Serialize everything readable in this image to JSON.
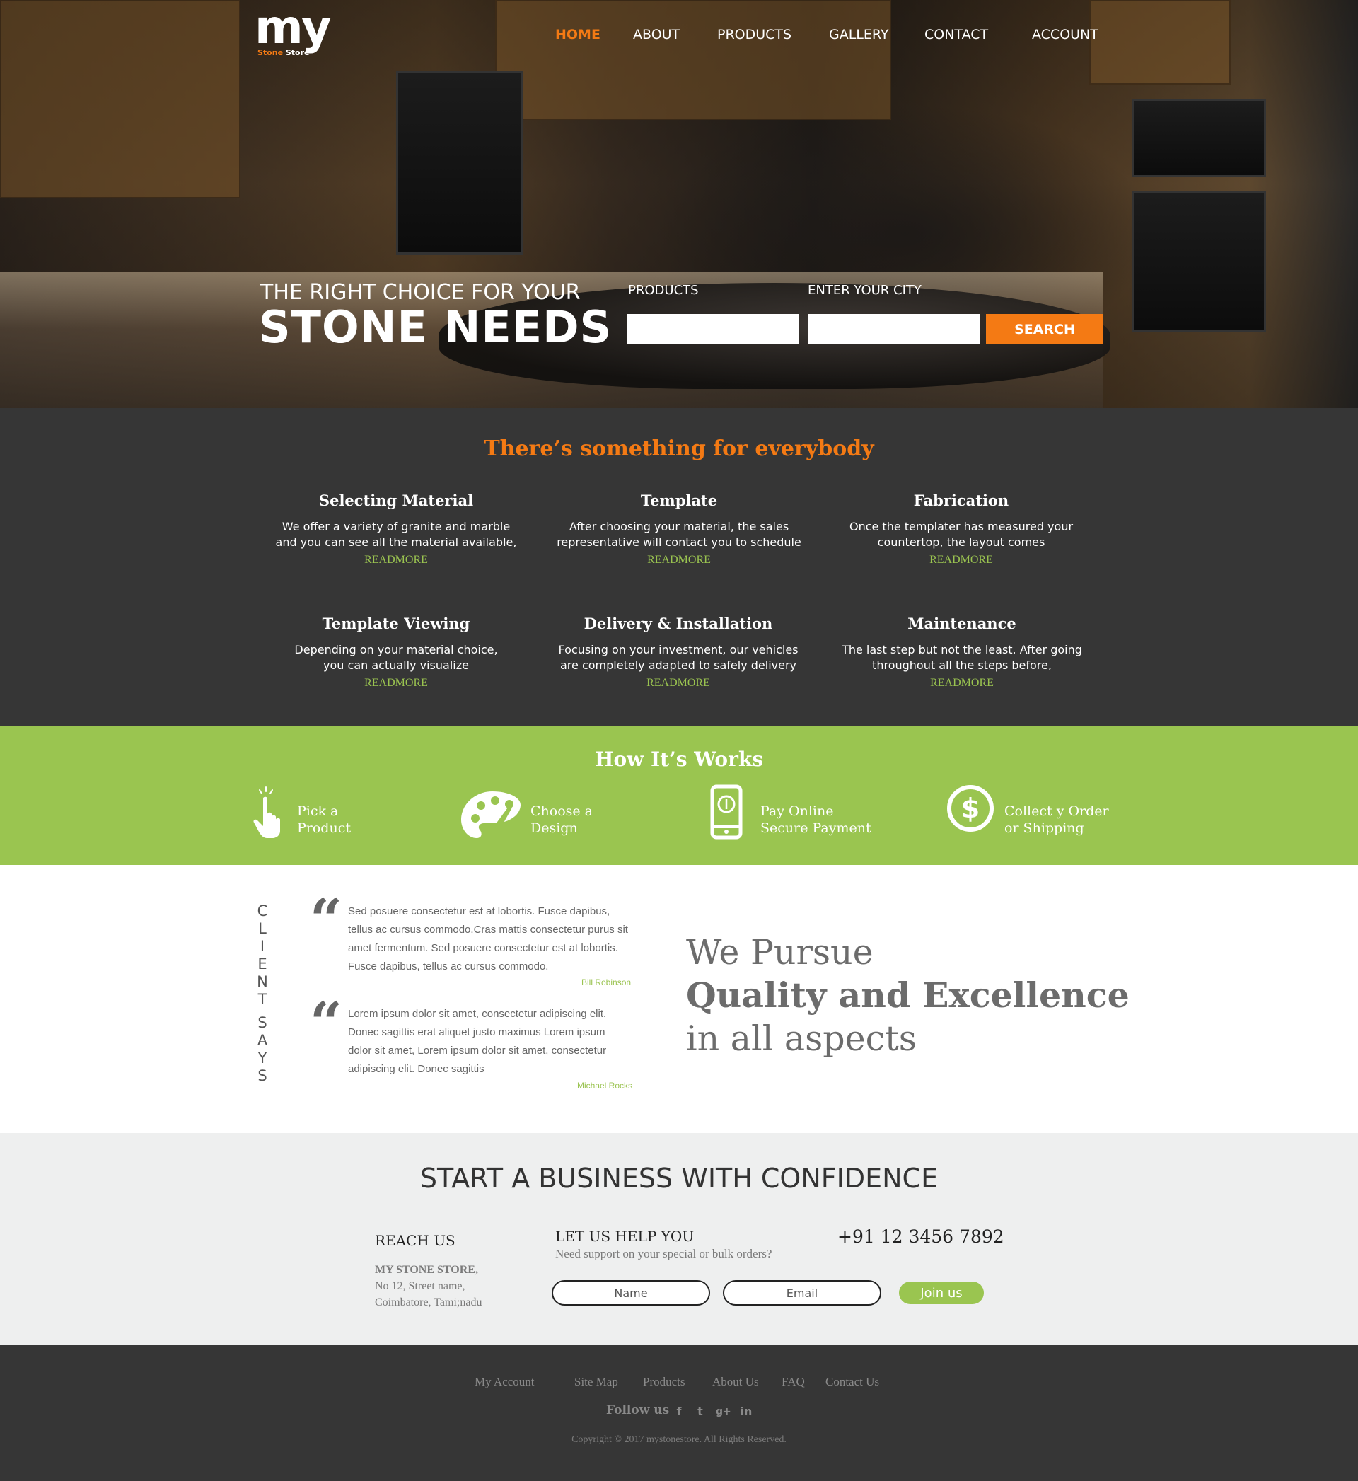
{
  "brand": {
    "logo_main": "my",
    "logo_sub_accent": "Stone",
    "logo_sub_rest": "Store"
  },
  "nav": {
    "items": [
      "HOME",
      "ABOUT",
      "PRODUCTS",
      "GALLERY",
      "CONTACT",
      "ACCOUNT"
    ],
    "active": "HOME"
  },
  "hero": {
    "subtitle": "THE RIGHT CHOICE  FOR YOUR",
    "title": "STONE NEEDS",
    "products_label": "PRODUCTS",
    "city_label": "ENTER YOUR CITY",
    "products_value": "",
    "city_value": "",
    "search_label": "SEARCH"
  },
  "services": {
    "title": "There’s something for everybody",
    "readmore": "READMORE",
    "items": [
      {
        "title": "Selecting Material",
        "line1": "We offer a variety of granite and marble",
        "line2": "and you can see all the material available,"
      },
      {
        "title": "Template",
        "line1": "After choosing your material, the sales",
        "line2": "representative will contact you to schedule"
      },
      {
        "title": "Fabrication",
        "line1": "Once the templater has measured your",
        "line2": "countertop, the layout comes"
      },
      {
        "title": "Template Viewing",
        "line1": "Depending on your material choice,",
        "line2": "you can actually visualize"
      },
      {
        "title": "Delivery & Installation",
        "line1": "Focusing on your investment, our vehicles",
        "line2": "are completely adapted to safely delivery"
      },
      {
        "title": "Maintenance",
        "line1": "The last step but not the least. After going",
        "line2": "throughout all the steps before,"
      }
    ]
  },
  "how": {
    "title": "How It’s Works",
    "steps": [
      {
        "icon": "hand-pointer-icon",
        "line1": "Pick  a",
        "line2": "Product"
      },
      {
        "icon": "palette-icon",
        "line1": "Choose a",
        "line2": "Design"
      },
      {
        "icon": "mobile-pay-icon",
        "line1": "Pay Online",
        "line2": "Secure Payment"
      },
      {
        "icon": "dollar-circle-icon",
        "line1": "Collect y Order",
        "line2": "or Shipping"
      }
    ]
  },
  "testimonials": {
    "heading_letters": [
      "C",
      "L",
      "I",
      "E",
      "N",
      "T",
      "",
      "S",
      "A",
      "Y",
      "S"
    ],
    "quotes": [
      {
        "lines": [
          "Sed posuere consectetur est at lobortis. Fusce dapibus,",
          "tellus ac cursus commodo.Cras mattis consectetur purus sit",
          "amet fermentum. Sed posuere consectetur est at lobortis.",
          "Fusce dapibus, tellus ac cursus commodo."
        ],
        "author": "Bill Robinson"
      },
      {
        "lines": [
          "Lorem ipsum dolor sit amet, consectetur adipiscing elit.",
          "Donec sagittis erat aliquet justo maximus  Lorem ipsum",
          "dolor sit amet,  Lorem ipsum dolor sit amet, consectetur",
          "adipiscing elit. Donec sagittis"
        ],
        "author": "Michael Rocks"
      }
    ],
    "pursue_line1": "We Pursue",
    "pursue_line2": "Quality and Excellence",
    "pursue_line3": "in all aspects"
  },
  "business": {
    "title": "START A BUSINESS WITH CONFIDENCE",
    "reach_heading": "REACH US",
    "store_name": "MY STONE STORE,",
    "address_line1": "No 12, Street name,",
    "address_line2": "Coimbatore, Tami;nadu",
    "help_heading": "LET US HELP YOU",
    "help_sub": "Need support on your special or bulk orders?",
    "phone": "+91 12 3456 7892",
    "name_placeholder": "Name",
    "email_placeholder": "Email",
    "join_label": "Join us"
  },
  "footer": {
    "links": [
      "My Account",
      "Site Map",
      "Products",
      "About Us",
      "FAQ",
      "Contact Us"
    ],
    "follow_label": "Follow us",
    "social": [
      "facebook-icon",
      "twitter-icon",
      "google-plus-icon",
      "linkedin-icon"
    ],
    "social_glyphs": [
      "f",
      "t",
      "g+",
      "in"
    ],
    "copyright": "Copyright  © 2017  mystonestore.  All Rights Reserved."
  },
  "colors": {
    "accent_orange": "#f47a14",
    "accent_green": "#9ac550",
    "dark_bg": "#363636"
  }
}
